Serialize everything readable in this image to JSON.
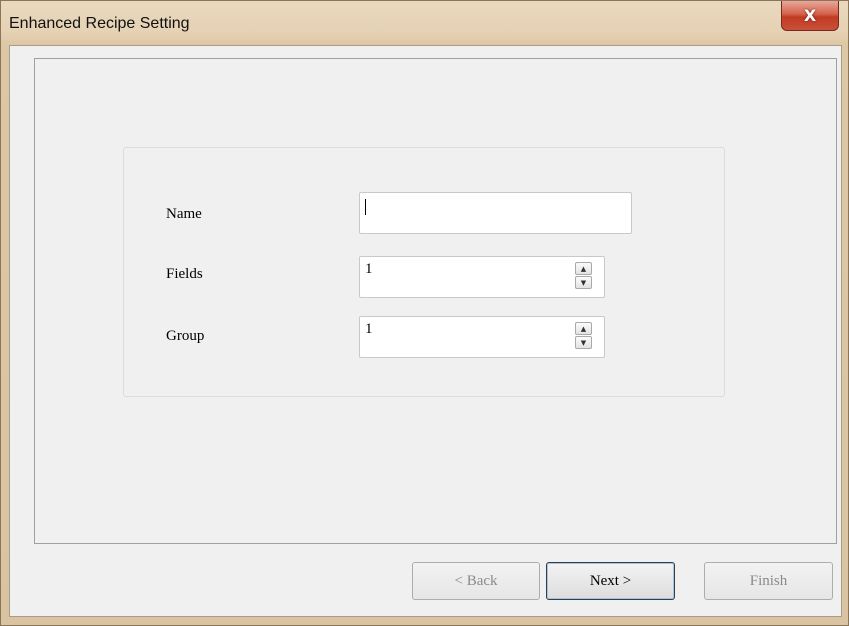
{
  "window": {
    "title": "Enhanced Recipe Setting",
    "close_glyph": "X"
  },
  "form": {
    "name": {
      "label": "Name",
      "value": ""
    },
    "fields": {
      "label": "Fields",
      "value": "1"
    },
    "group": {
      "label": "Group",
      "value": "1"
    },
    "spin_up_glyph": "▲",
    "spin_down_glyph": "▼"
  },
  "footer": {
    "back_label": "< Back",
    "next_label": "Next >",
    "finish_label": "Finish"
  },
  "icons": {
    "close": "close-icon",
    "spin_up": "chevron-up-icon",
    "spin_down": "chevron-down-icon"
  }
}
